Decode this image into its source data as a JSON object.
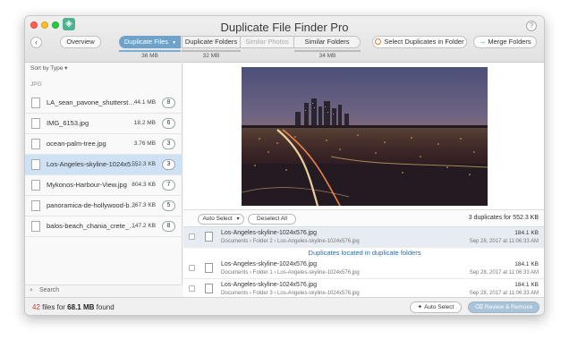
{
  "app": {
    "title": "Duplicate File Finder Pro",
    "help": "?"
  },
  "nav": {
    "back": "‹",
    "overview": "Overview"
  },
  "tabs": {
    "duplicate_files": "Duplicate Files",
    "duplicate_files_arrow": "▾",
    "duplicate_folders": "Duplicate Folders",
    "similar_photos": "Similar Photos",
    "similar_folders": "Similar Folders",
    "duplicate_files_size": "36 MB",
    "duplicate_folders_size": "32 MB",
    "similar_folders_size": "34 MB"
  },
  "actions": {
    "select_duplicates": "Select Duplicates in Folder",
    "merge_folders": "Merge Folders"
  },
  "sidebar": {
    "sort_label": "Sort by Type ▾",
    "group": "JPG",
    "files": [
      {
        "name": "LA_sean_pavone_shutterstock.jpg",
        "size": "44.1 MB",
        "count": "8"
      },
      {
        "name": "IMG_6153.jpg",
        "size": "18.2 MB",
        "count": "6"
      },
      {
        "name": "ocean-palm-tree.jpg",
        "size": "3.76 MB",
        "count": "3"
      },
      {
        "name": "Los-Angeles-skyline-1024x576.jpg",
        "size": "552.3 KB",
        "count": "3"
      },
      {
        "name": "Mykonos-Harbour-View.jpg",
        "size": "804.3 KB",
        "count": "7"
      },
      {
        "name": "panoramica-de-hollywood-boulevard.jpg",
        "size": "367.3 KB",
        "count": "5"
      },
      {
        "name": "balos-beach_chania_crete_greece.jpg",
        "size": "147.2 KB",
        "count": "8"
      }
    ],
    "search_icon": "⌕",
    "search_placeholder": "Search"
  },
  "detail": {
    "auto_select": "Auto Select",
    "auto_select_arrow": "▾",
    "deselect_all": "Deselect All",
    "dup_count": "3 duplicates for 552.3 KB",
    "original": {
      "name": "Los-Angeles-skyline-1024x576.jpg",
      "path": "Documents › Folder 2 › Los-Angeles-skyline-1024x576.jpg",
      "size": "184.1 KB",
      "date": "Sep 28, 2017 at 11:06:33 AM"
    },
    "section_title": "Duplicates located in duplicate folders",
    "duplicates": [
      {
        "name": "Los-Angeles-skyline-1024x576.jpg",
        "path": "Documents › Folder 1 › Los-Angeles-skyline-1024x576.jpg",
        "size": "184.1 KB",
        "date": "Sep 28, 2017 at 11:06:33 AM"
      },
      {
        "name": "Los-Angeles-skyline-1024x576.jpg",
        "path": "Documents › Folder 3 › Los-Angeles-skyline-1024x576.jpg",
        "size": "184.1 KB",
        "date": "Sep 28, 2017 at 11:06:33 AM"
      }
    ]
  },
  "footer": {
    "count": "42",
    "files_for": "files for",
    "total": "68.1 MB",
    "found": "found",
    "auto_select": "Auto Select",
    "review_remove": "Review & Remove"
  },
  "colors": {
    "accent": "#6fa2c9",
    "selected_row": "#cfe1f5",
    "count_red": "#d9352a"
  }
}
